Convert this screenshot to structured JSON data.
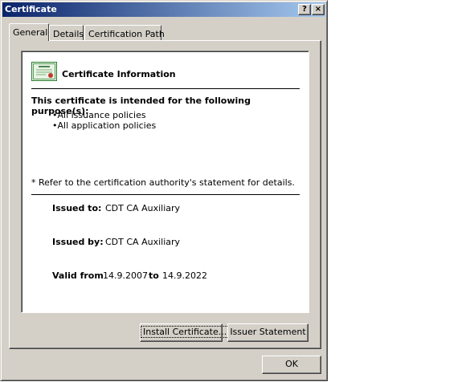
{
  "window": {
    "title": "Certificate",
    "help_glyph": "?",
    "close_glyph": "×"
  },
  "tabs": [
    {
      "label": "General",
      "active": true
    },
    {
      "label": "Details",
      "active": false
    },
    {
      "label": "Certification Path",
      "active": false
    }
  ],
  "general": {
    "icon": "certificate-icon",
    "heading": "Certificate Information",
    "purpose_heading": "This certificate is intended for the following purpose(s):",
    "purposes": [
      "•All issuance policies",
      "•All application policies"
    ],
    "note": "* Refer to the certification authority's statement for details.",
    "issued_to_label": "Issued to:",
    "issued_to": "CDT CA Auxiliary",
    "issued_by_label": "Issued by:",
    "issued_by": "CDT CA Auxiliary",
    "valid_from_label": "Valid from",
    "valid_from": "14.9.2007",
    "to_label": "to",
    "valid_to": "14.9.2022"
  },
  "buttons": {
    "install": "Install Certificate...",
    "issuer_statement": "Issuer Statement",
    "ok": "OK"
  },
  "colors": {
    "titlebar_start": "#0a246a",
    "titlebar_end": "#a6caf0",
    "face": "#d4d0c8"
  }
}
